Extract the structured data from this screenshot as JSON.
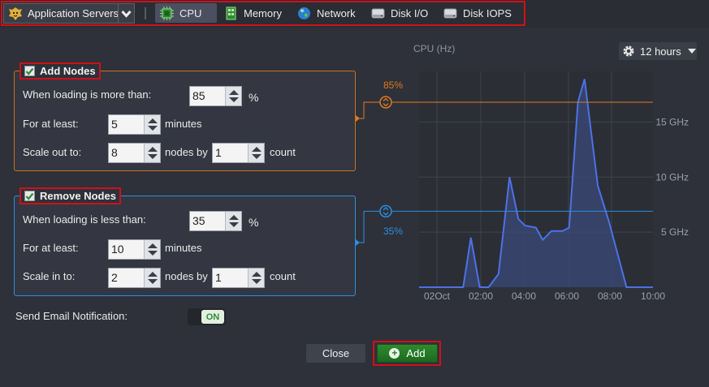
{
  "topbar": {
    "env_select": {
      "label": "Application Servers",
      "icon": "lion-mascot-icon"
    },
    "tabs": [
      {
        "label": "CPU",
        "icon": "cpu-chip-icon",
        "active": true
      },
      {
        "label": "Memory",
        "icon": "memory-module-icon",
        "active": false
      },
      {
        "label": "Network",
        "icon": "globe-icon",
        "active": false
      },
      {
        "label": "Disk I/O",
        "icon": "hard-disk-icon",
        "active": false
      },
      {
        "label": "Disk IOPS",
        "icon": "hard-disk-icon",
        "active": false
      }
    ]
  },
  "add_nodes": {
    "title": "Add Nodes",
    "checked": true,
    "when_label": "When loading is more than:",
    "threshold": "85",
    "threshold_unit": "%",
    "for_label": "For at least:",
    "duration": "5",
    "duration_unit": "minutes",
    "scale_label": "Scale out to:",
    "nodes": "8",
    "nodes_by_label": "nodes by",
    "step": "1",
    "count_label": "count"
  },
  "remove_nodes": {
    "title": "Remove Nodes",
    "checked": true,
    "when_label": "When loading is less than:",
    "threshold": "35",
    "threshold_unit": "%",
    "for_label": "For at least:",
    "duration": "10",
    "duration_unit": "minutes",
    "scale_label": "Scale in to:",
    "nodes": "2",
    "nodes_by_label": "nodes by",
    "step": "1",
    "count_label": "count"
  },
  "notification": {
    "label": "Send Email Notification:",
    "toggle": "ON"
  },
  "buttons": {
    "close": "Close",
    "add": "Add"
  },
  "period": {
    "label": "12 hours",
    "icon": "gear-icon"
  },
  "chart_data": {
    "type": "area",
    "title": "CPU (Hz)",
    "x_ticks": [
      "02Oct",
      "02:00",
      "04:00",
      "06:00",
      "08:00",
      "10:00"
    ],
    "y_ticks": [
      "5 GHz",
      "10 GHz",
      "15 GHz"
    ],
    "y_unit": "GHz",
    "ylim": [
      0,
      19.6
    ],
    "x_unit": "hours since 00:00",
    "xlim": [
      0,
      10.6
    ],
    "series": [
      {
        "color": "#4d72e6",
        "x": [
          0,
          2.0,
          2.35,
          2.75,
          3.15,
          3.6,
          4.1,
          4.5,
          4.8,
          5.3,
          5.6,
          6.0,
          6.5,
          6.8,
          7.2,
          7.5,
          8.1,
          8.6,
          9.4,
          10.6
        ],
        "y": [
          0,
          0,
          4.5,
          0,
          0,
          1.2,
          10.0,
          6.2,
          5.6,
          5.4,
          4.3,
          5.1,
          5.1,
          5.4,
          16.8,
          18.9,
          9.2,
          6.0,
          0,
          0
        ]
      }
    ],
    "thresholds": [
      {
        "label": "85%",
        "value": 16.8,
        "color": "#e07a1f"
      },
      {
        "label": "35%",
        "value": 6.9,
        "color": "#2a8ee0"
      }
    ]
  }
}
